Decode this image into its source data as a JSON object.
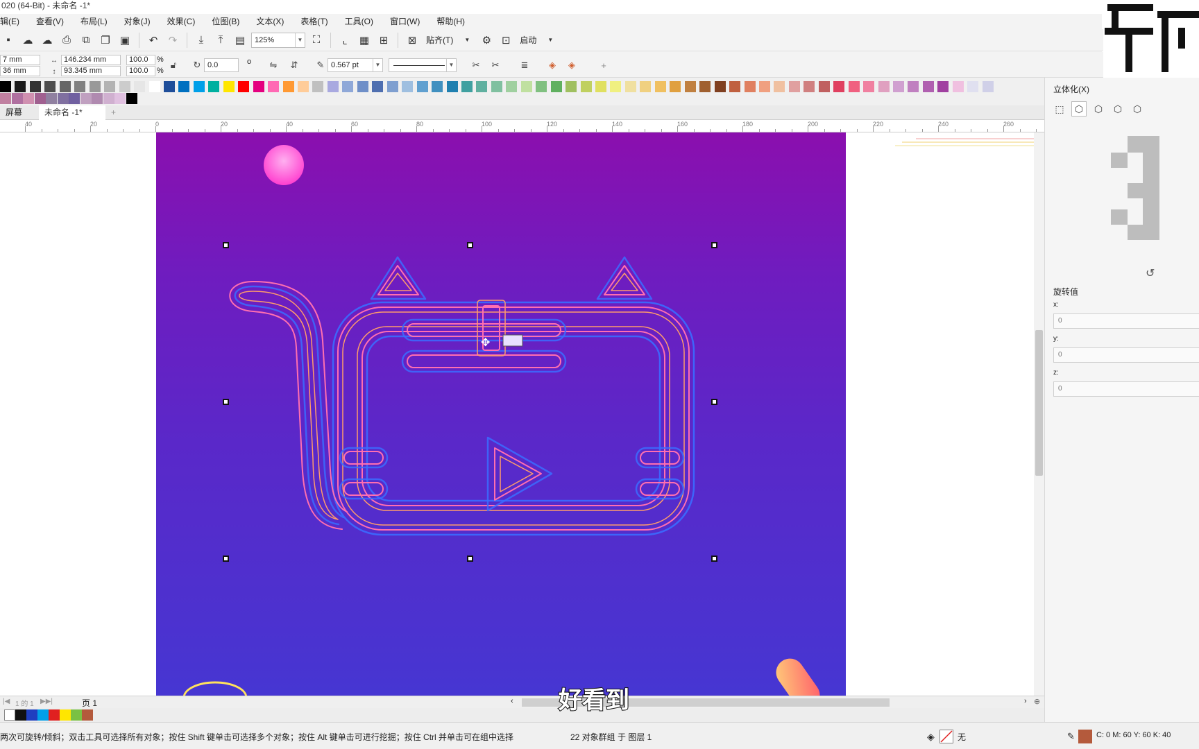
{
  "window": {
    "title": "020 (64-Bit) - 未命名 -1*"
  },
  "menu": [
    "辑(E)",
    "查看(V)",
    "布局(L)",
    "对象(J)",
    "效果(C)",
    "位图(B)",
    "文本(X)",
    "表格(T)",
    "工具(O)",
    "窗口(W)",
    "帮助(H)"
  ],
  "toolbar": {
    "zoom": "125%",
    "snap_label": "贴齐(T)",
    "launch_label": "启动"
  },
  "propbar": {
    "x_val": "7 mm",
    "y_val": "36 mm",
    "width": "146.234 mm",
    "height": "93.345 mm",
    "scale_x": "100.0",
    "scale_y": "100.0",
    "percent": "%",
    "rotation": "0.0",
    "degree": "o",
    "outline_width": "0.567 pt"
  },
  "doc_tabs": {
    "home": "屏幕",
    "doc": "未命名 -1*",
    "add": "+"
  },
  "ruler": {
    "labels": [
      "40",
      "20",
      "0",
      "20",
      "40",
      "60",
      "80",
      "100",
      "120",
      "140",
      "160",
      "180",
      "200",
      "220",
      "240",
      "260"
    ]
  },
  "side_panel": {
    "title": "立体化(X)",
    "rotation_label": "旋转值",
    "x_label": "x:",
    "x_value": "0",
    "y_label": "y:",
    "y_value": "0",
    "z_label": "z:",
    "z_value": "0"
  },
  "page_nav": {
    "counter": "1 的 1",
    "page_label": "页 1"
  },
  "status": {
    "hint": "两次可旋转/倾斜；双击工具可选择所有对象；按住 Shift 键单击可选择多个对象；按住 Alt 键单击可进行挖掘；按住 Ctrl 并单击可在组中选择",
    "selection": "22 对象群组 于 图层 1",
    "fill_none": "无",
    "color_readout": "C: 0 M: 60 Y: 60 K: 40"
  },
  "subtitle": "好看到",
  "colors": {
    "page_top": "#8b0fae",
    "page_bottom": "#4636d2",
    "neon_pink": "#ff6fb0",
    "neon_blue": "#3b6cff",
    "neon_orange": "#ff9c6a",
    "fill_swatch": "#b45a3c"
  },
  "palette_colors": [
    "#000000",
    "#1a1a1a",
    "#333333",
    "#4d4d4d",
    "#666666",
    "#808080",
    "#999999",
    "#b3b3b3",
    "#cccccc",
    "#e6e6e6",
    "#ffffff",
    "#1f4e9a",
    "#0070c0",
    "#00a0e9",
    "#00b0a0",
    "#ffe600",
    "#ff0000",
    "#e4007f",
    "#ff69b4",
    "#ff9933",
    "#ffcc99",
    "#c0c0c0",
    "#a9a9e0",
    "#8fa8d8",
    "#6f8fc8",
    "#4f6fb0",
    "#7f9fd0",
    "#9fbfe0",
    "#60a0d0",
    "#4090c0",
    "#2080b0",
    "#40a0a0",
    "#60b0a0",
    "#80c0a0",
    "#a0d0a0",
    "#c0e0a0",
    "#80c080",
    "#60b060",
    "#a0c060",
    "#c0d060",
    "#e0e060",
    "#f0f080",
    "#f0e0a0",
    "#f0d080",
    "#f0c060",
    "#e0a040",
    "#c08040",
    "#a06030",
    "#804020",
    "#c06040",
    "#e08060",
    "#f0a080",
    "#f0c0a0",
    "#e0a0a0",
    "#d08080",
    "#c06060",
    "#e04060",
    "#f06080",
    "#f080a0",
    "#e0a0c0",
    "#d0a0d0",
    "#c080c0",
    "#b060b0",
    "#a040a0",
    "#f0c0e0",
    "#e0e0f0",
    "#d0d0e8"
  ]
}
